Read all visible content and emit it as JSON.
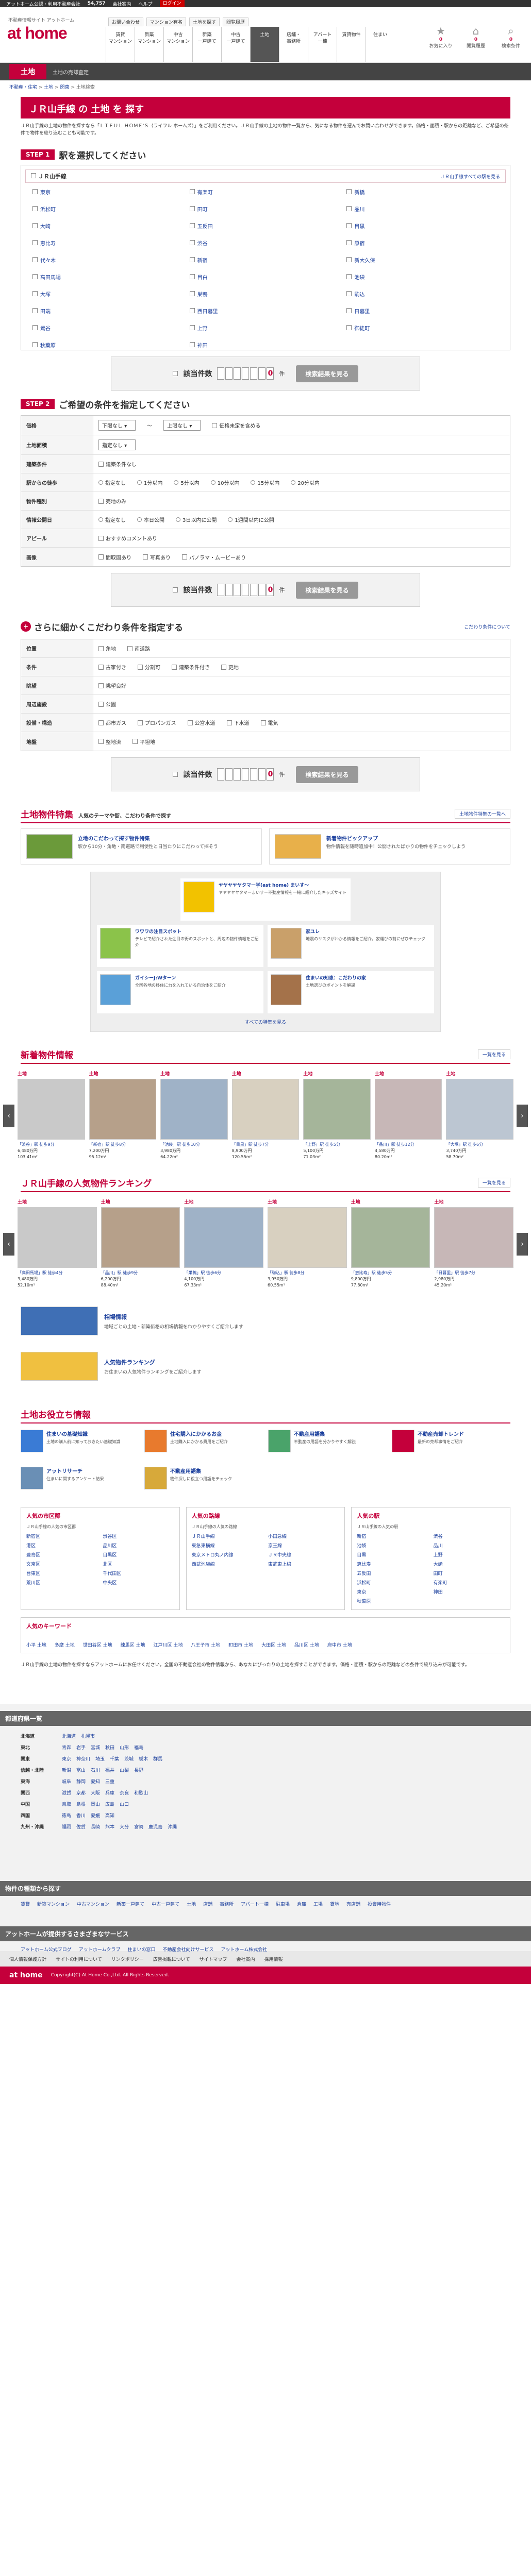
{
  "topbar": {
    "text": "アットホーム公認・利用不動産会社",
    "count": "54,757",
    "suffix": "店",
    "link1": "会社案内",
    "link2": "ヘルプ",
    "btn": "ログイン"
  },
  "header": {
    "tagline": "不動産情報サイト アットホーム",
    "logo": "at home",
    "meta": [
      "お問い合わせ",
      "マンション有名",
      "土地を探す",
      "閲覧履歴"
    ],
    "nav": [
      {
        "label": "賃貸\nマンション"
      },
      {
        "label": "新築\nマンション"
      },
      {
        "label": "中古\nマンション"
      },
      {
        "label": "新築\n一戸建て"
      },
      {
        "label": "中古\n一戸建て"
      },
      {
        "label": "土地",
        "active": true
      },
      {
        "label": "店舗・\n事務所"
      },
      {
        "label": "アパート\n一棟"
      },
      {
        "label": "賃貸物件"
      },
      {
        "label": "住まい"
      }
    ],
    "icons": [
      {
        "label": "お気に入り",
        "count": "0"
      },
      {
        "label": "閲覧履歴",
        "count": "0"
      },
      {
        "label": "検索条件",
        "count": "0"
      }
    ]
  },
  "category": {
    "tab": "土地",
    "sub": "土地の売却査定"
  },
  "breadcrumb": [
    "不動産・住宅",
    "土地",
    "関東",
    "土地検索"
  ],
  "title": "ＪＲ山手線 の 土地 を 探す",
  "intro": "ＪＲ山手線の土地の物件を探すなら「ＬＩＦＵＬ ＨＯＭＥ'Ｓ（ライフル ホームズ）」をご利用ください。ＪＲ山手線の土地の物件一覧から、気になる物件を選んでお問い合わせができます。価格・面積・駅からの距離など、ご希望の条件で物件を絞り込むことも可能です。",
  "step1": {
    "label": "STEP 1",
    "title": "駅を選択してください",
    "rail": "ＪＲ山手線",
    "all_link": "ＪＲ山手線すべての駅を見る",
    "stations": [
      "東京",
      "有楽町",
      "新橋",
      "浜松町",
      "田町",
      "品川",
      "大崎",
      "五反田",
      "目黒",
      "恵比寿",
      "渋谷",
      "原宿",
      "代々木",
      "新宿",
      "新大久保",
      "高田馬場",
      "目白",
      "池袋",
      "大塚",
      "巣鴨",
      "駒込",
      "田端",
      "西日暮里",
      "日暮里",
      "鶯谷",
      "上野",
      "御徒町",
      "秋葉原",
      "神田"
    ]
  },
  "search": {
    "label": "該当件数",
    "digits": [
      "",
      "",
      "",
      "",
      "",
      "",
      "0"
    ],
    "unit": "件",
    "btn": "検索結果を見る"
  },
  "step2": {
    "label": "STEP 2",
    "title": "ご希望の条件を指定してください",
    "rows": [
      {
        "label": "価格",
        "items": [
          "下限なし",
          "〜",
          "上限なし",
          "価格未定を含める"
        ]
      },
      {
        "label": "土地面積",
        "items": [
          "指定なし"
        ]
      },
      {
        "label": "建築条件",
        "items": [
          "建築条件なし"
        ]
      },
      {
        "label": "駅からの徒歩",
        "items": [
          "指定なし",
          "1分以内",
          "5分以内",
          "10分以内",
          "15分以内",
          "20分以内"
        ]
      },
      {
        "label": "物件種別",
        "items": [
          "売地のみ"
        ]
      },
      {
        "label": "情報公開日",
        "items": [
          "指定なし",
          "本日公開",
          "3日以内に公開",
          "1週間以内に公開"
        ]
      },
      {
        "label": "アピール",
        "items": [
          "おすすめコメントあり"
        ]
      },
      {
        "label": "画像",
        "items": [
          "間取図あり",
          "写真あり",
          "パノラマ・ムービーあり"
        ]
      }
    ]
  },
  "kodawari": {
    "title": "さらに細かくこだわり条件を指定する",
    "link": "こだわり条件について"
  },
  "kodawari_rows": [
    {
      "label": "位置",
      "items": [
        "角地",
        "南道路"
      ]
    },
    {
      "label": "条件",
      "items": [
        "古家付き",
        "分割可",
        "建築条件付き",
        "更地"
      ]
    },
    {
      "label": "眺望",
      "items": [
        "眺望良好"
      ]
    },
    {
      "label": "周辺施設",
      "items": [
        "公園"
      ]
    },
    {
      "label": "設備・構造",
      "items": [
        "都市ガス",
        "プロパンガス",
        "公営水道",
        "下水道",
        "電気"
      ]
    },
    {
      "label": "地盤",
      "items": [
        "整地済",
        "平坦地"
      ]
    }
  ],
  "feature": {
    "title": "土地物件特集",
    "sub": "人気のテーマや街、こだわり条件で探す",
    "link": "土地物件特集の一覧へ",
    "cards": [
      {
        "t": "立地のこだわって探す物件特集",
        "d": "駅から10分・角地・南道路で利便性と日当たりにこだわって探そう"
      },
      {
        "t": "新着物件ピックアップ",
        "d": "物件情報を随時追加中！公開されたばかりの物件をチェックしよう"
      }
    ],
    "box": [
      {
        "t": "ヤヤヤヤヤタマー学(ast home) まいす〜",
        "d": "ヤヤヤヤヤタマーまいすー不動産情報を一緒に紹介したキッズサイト"
      },
      {
        "t": "ワワワの注目スポット",
        "d": "テレビで紹介された注目の街のスポットと、周辺の物件情報をご紹介"
      },
      {
        "t": "家ユレ",
        "d": "地震のリスクがわかる情報をご紹介。家選びの前にぜひチェック"
      },
      {
        "t": "ガイシーJ:Wターン",
        "d": "全国各地の移住に力を入れている自治体をご紹介"
      },
      {
        "t": "住まいの知恵：こだわりの家",
        "d": "土地選びのポイントを解説"
      }
    ],
    "more": "すべての特集を見る"
  },
  "newlist": {
    "title": "新着物件情報",
    "link": "一覧を見る",
    "cards": [
      {
        "tag": "土地",
        "name": "「渋谷」駅 徒歩9分",
        "price": "6,480万円",
        "area": "103.41m²"
      },
      {
        "tag": "土地",
        "name": "「新宿」駅 徒歩8分",
        "price": "7,200万円",
        "area": "95.12m²"
      },
      {
        "tag": "土地",
        "name": "「池袋」駅 徒歩10分",
        "price": "3,980万円",
        "area": "64.22m²"
      },
      {
        "tag": "土地",
        "name": "「目黒」駅 徒歩7分",
        "price": "8,900万円",
        "area": "120.55m²"
      },
      {
        "tag": "土地",
        "name": "「上野」駅 徒歩5分",
        "price": "5,100万円",
        "area": "71.03m²"
      },
      {
        "tag": "土地",
        "name": "「品川」駅 徒歩12分",
        "price": "4,580万円",
        "area": "80.20m²"
      },
      {
        "tag": "土地",
        "name": "「大塚」駅 徒歩6分",
        "price": "3,740万円",
        "area": "58.70m²"
      }
    ]
  },
  "ranking": {
    "title": "ＪＲ山手線の人気物件ランキング",
    "link": "一覧を見る",
    "cards": [
      {
        "tag": "土地",
        "name": "「高田馬場」駅 徒歩4分",
        "price": "3,480万円",
        "area": "52.10m²"
      },
      {
        "tag": "土地",
        "name": "「品川」駅 徒歩9分",
        "price": "6,200万円",
        "area": "88.40m²"
      },
      {
        "tag": "土地",
        "name": "「巣鴨」駅 徒歩6分",
        "price": "4,100万円",
        "area": "67.33m²"
      },
      {
        "tag": "土地",
        "name": "「駒込」駅 徒歩8分",
        "price": "3,950万円",
        "area": "60.55m²"
      },
      {
        "tag": "土地",
        "name": "「恵比寿」駅 徒歩5分",
        "price": "9,800万円",
        "area": "77.80m²"
      },
      {
        "tag": "土地",
        "name": "「日暮里」駅 徒歩7分",
        "price": "2,980万円",
        "area": "45.20m²"
      }
    ]
  },
  "promos": [
    {
      "t": "相場情報",
      "d": "地域ごとの土地・新築価格の相場情報をわかりやすくご紹介します"
    },
    {
      "t": "人気物件ランキング",
      "d": "お住まいの人気物件ランキングをご紹介します"
    }
  ],
  "useful": {
    "title": "土地お役立ち情報",
    "items": [
      {
        "t": "住まいの基礎知識",
        "d": "土地の購入前に知っておきたい基礎知識"
      },
      {
        "t": "住宅購入にかかるお金",
        "d": "土地購入にかかる費用をご紹介"
      },
      {
        "t": "不動産用語集",
        "d": "不動産の用語を分かりやすく解説"
      },
      {
        "t": "不動産売却トレンド",
        "d": "最新の売却事情をご紹介"
      },
      {
        "t": "アットリサーチ",
        "d": "住まいに関するアンケート結果"
      },
      {
        "t": "不動産用語集",
        "d": "物件探しに役立つ用語をチェック"
      }
    ]
  },
  "pop": [
    {
      "title": "人気の市区郡",
      "desc": "ＪＲ山手線の人気の市区郡",
      "items": [
        "新宿区",
        "渋谷区",
        "港区",
        "品川区",
        "豊島区",
        "目黒区",
        "文京区",
        "北区",
        "台東区",
        "千代田区",
        "荒川区",
        "中央区"
      ]
    },
    {
      "title": "人気の路線",
      "desc": "ＪＲ山手線の人気の路線",
      "items": [
        "ＪＲ山手線",
        "小田急線",
        "東急東横線",
        "京王線",
        "東京メトロ丸ノ内線",
        "ＪＲ中央線",
        "西武池袋線",
        "東武東上線"
      ]
    },
    {
      "title": "人気の駅",
      "desc": "ＪＲ山手線の人気の駅",
      "items": [
        "新宿",
        "渋谷",
        "池袋",
        "品川",
        "目黒",
        "上野",
        "恵比寿",
        "大崎",
        "五反田",
        "田町",
        "浜松町",
        "有楽町",
        "東京",
        "神田",
        "秋葉原"
      ]
    }
  ],
  "keywords": {
    "title": "人気のキーワード",
    "items": [
      "小平 土地",
      "多摩 土地",
      "世田谷区 土地",
      "練馬区 土地",
      "江戸川区 土地",
      "八王子市 土地",
      "町田市 土地",
      "大田区 土地",
      "品川区 土地",
      "府中市 土地"
    ]
  },
  "desc": "ＪＲ山手線の土地の物件を探すならアットホームにお任せください。全国の不動産会社の物件情報から、あなたにぴったりの土地を探すことができます。価格・面積・駅からの距離などの条件で絞り込みが可能です。",
  "sitemap": {
    "title": "都道府県一覧",
    "regions": [
      {
        "r": "北海道",
        "p": [
          "北海道",
          "札幌市"
        ]
      },
      {
        "r": "東北",
        "p": [
          "青森",
          "岩手",
          "宮城",
          "秋田",
          "山形",
          "福島"
        ]
      },
      {
        "r": "関東",
        "p": [
          "東京",
          "神奈川",
          "埼玉",
          "千葉",
          "茨城",
          "栃木",
          "群馬"
        ]
      },
      {
        "r": "信越・北陸",
        "p": [
          "新潟",
          "富山",
          "石川",
          "福井",
          "山梨",
          "長野"
        ]
      },
      {
        "r": "東海",
        "p": [
          "岐阜",
          "静岡",
          "愛知",
          "三重"
        ]
      },
      {
        "r": "関西",
        "p": [
          "滋賀",
          "京都",
          "大阪",
          "兵庫",
          "奈良",
          "和歌山"
        ]
      },
      {
        "r": "中国",
        "p": [
          "鳥取",
          "島根",
          "岡山",
          "広島",
          "山口"
        ]
      },
      {
        "r": "四国",
        "p": [
          "徳島",
          "香川",
          "愛媛",
          "高知"
        ]
      },
      {
        "r": "九州・沖縄",
        "p": [
          "福岡",
          "佐賀",
          "長崎",
          "熊本",
          "大分",
          "宮崎",
          "鹿児島",
          "沖縄"
        ]
      }
    ]
  },
  "types": {
    "title": "物件の種類から探す",
    "items": [
      "賃貸",
      "新築マンション",
      "中古マンション",
      "新築一戸建て",
      "中古一戸建て",
      "土地",
      "店舗",
      "事務所",
      "アパート一棟",
      "駐車場",
      "倉庫",
      "工場",
      "貸地",
      "売店舗",
      "投資用物件"
    ]
  },
  "services": {
    "title": "アットホームが提供するさまざまなサービス",
    "items": [
      "アットホーム公式ブログ",
      "アットホームクラブ",
      "住まいの窓口",
      "不動産会社向けサービス",
      "アットホーム株式会社"
    ]
  },
  "footnav": [
    "個人情報保護方針",
    "サイトの利用について",
    "リンクポリシー",
    "広告掲載について",
    "サイトマップ",
    "会社案内",
    "採用情報"
  ],
  "footer": {
    "logo": "at home",
    "copy": "Copyright(C) At Home Co.,Ltd. All Rights Reserved."
  },
  "pagetop": "ページの先頭へ"
}
